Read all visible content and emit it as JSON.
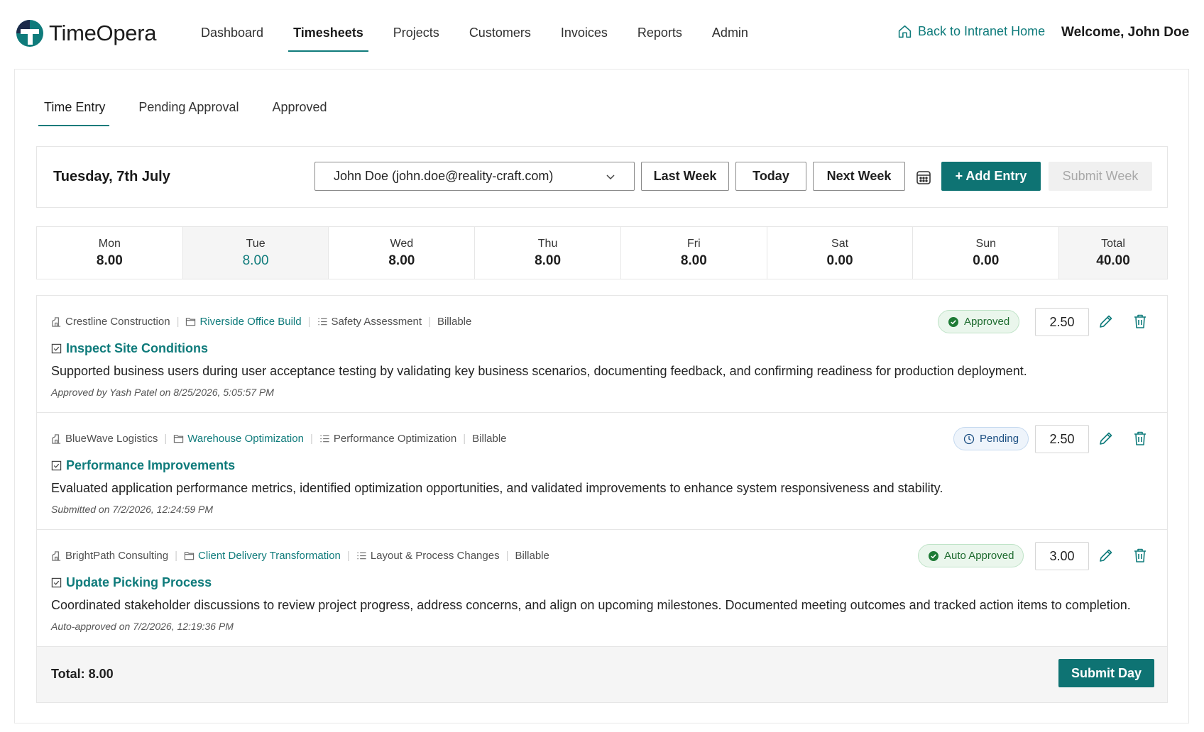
{
  "brand": {
    "name": "TimeOpera"
  },
  "nav": {
    "items": [
      {
        "label": "Dashboard",
        "active": false
      },
      {
        "label": "Timesheets",
        "active": true
      },
      {
        "label": "Projects",
        "active": false
      },
      {
        "label": "Customers",
        "active": false
      },
      {
        "label": "Invoices",
        "active": false
      },
      {
        "label": "Reports",
        "active": false
      },
      {
        "label": "Admin",
        "active": false
      }
    ],
    "back_link": "Back to Intranet Home",
    "welcome": "Welcome, John Doe"
  },
  "tabs": [
    {
      "label": "Time Entry",
      "active": true
    },
    {
      "label": "Pending Approval",
      "active": false
    },
    {
      "label": "Approved",
      "active": false
    }
  ],
  "toolbar": {
    "date": "Tuesday, 7th July",
    "user_select": "John Doe (john.doe@reality-craft.com)",
    "last_week": "Last Week",
    "today": "Today",
    "next_week": "Next Week",
    "add_entry": "+ Add Entry",
    "submit_week": "Submit Week"
  },
  "week": {
    "days": [
      {
        "name": "Mon",
        "hours": "8.00"
      },
      {
        "name": "Tue",
        "hours": "8.00",
        "selected": true
      },
      {
        "name": "Wed",
        "hours": "8.00"
      },
      {
        "name": "Thu",
        "hours": "8.00"
      },
      {
        "name": "Fri",
        "hours": "8.00"
      },
      {
        "name": "Sat",
        "hours": "0.00"
      },
      {
        "name": "Sun",
        "hours": "0.00"
      }
    ],
    "total_label": "Total",
    "total_hours": "40.00"
  },
  "entries": [
    {
      "customer": "Crestline Construction",
      "project": "Riverside Office Build",
      "activity": "Safety Assessment",
      "billing": "Billable",
      "task": "Inspect Site Conditions",
      "description": "Supported business users during user acceptance testing by validating key business scenarios, documenting feedback, and confirming readiness for production deployment.",
      "note": "Approved by Yash Patel on 8/25/2026, 5:05:57 PM",
      "status": "Approved",
      "hours": "2.50"
    },
    {
      "customer": "BlueWave Logistics",
      "project": "Warehouse Optimization",
      "activity": "Performance Optimization",
      "billing": "Billable",
      "task": "Performance Improvements",
      "description": "Evaluated application performance metrics, identified optimization opportunities, and validated improvements to enhance system responsiveness and stability.",
      "note": "Submitted on 7/2/2026, 12:24:59 PM",
      "status": "Pending",
      "hours": "2.50"
    },
    {
      "customer": "BrightPath Consulting",
      "project": "Client Delivery Transformation",
      "activity": "Layout & Process Changes",
      "billing": "Billable",
      "task": "Update Picking Process",
      "description": "Coordinated stakeholder discussions to review project progress, address concerns, and align on upcoming milestones. Documented meeting outcomes and tracked action items to completion.",
      "note": "Auto-approved on 7/2/2026, 12:19:36 PM",
      "status": "Auto Approved",
      "hours": "3.00"
    }
  ],
  "footer": {
    "total": "Total: 8.00",
    "submit_day": "Submit Day"
  },
  "colors": {
    "accent": "#0f7b7b",
    "approved_bg": "#eaf6ec",
    "approved_fg": "#1e6b2f",
    "pending_bg": "#eef4fb",
    "pending_fg": "#1c4f82"
  },
  "icons": {
    "home": "home-icon",
    "calendar": "calendar-icon",
    "customer": "building-icon",
    "project": "folder-icon",
    "activity": "list-icon",
    "task": "checkbox-icon",
    "approved": "check-circle-icon",
    "pending": "clock-icon",
    "edit": "pencil-icon",
    "delete": "trash-icon",
    "dropdown": "chevron-down-icon"
  }
}
